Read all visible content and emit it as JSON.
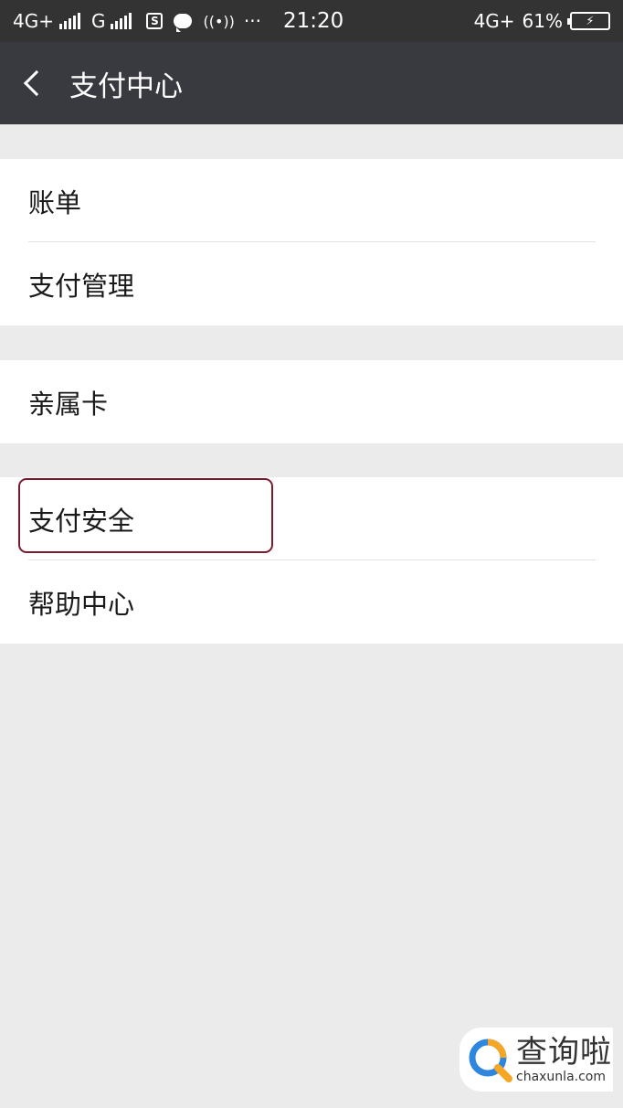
{
  "status_bar": {
    "network_1": "4G+",
    "network_2": "G",
    "app_icon": "S",
    "dots": "···",
    "time": "21:20",
    "network_right": "4G+",
    "battery": "61%"
  },
  "nav": {
    "title": "支付中心"
  },
  "menu": {
    "group1": [
      {
        "label": "账单"
      },
      {
        "label": "支付管理"
      }
    ],
    "group2": [
      {
        "label": "亲属卡"
      }
    ],
    "group3": [
      {
        "label": "支付安全"
      },
      {
        "label": "帮助中心"
      }
    ]
  },
  "watermark": {
    "cn": "查询啦",
    "en": "chaxunla.com"
  },
  "colors": {
    "status_bg": "#333333",
    "nav_bg": "#393a3f",
    "page_bg": "#ebebeb",
    "highlight": "#7b1b2f",
    "logo_blue": "#2e86de",
    "logo_orange": "#f5a623"
  },
  "icons": [
    "signal-bars-icon",
    "app-s-icon",
    "chat-bubble-icon",
    "hotspot-icon",
    "battery-icon",
    "back-chevron-icon",
    "search-magnifier-logo-icon"
  ]
}
